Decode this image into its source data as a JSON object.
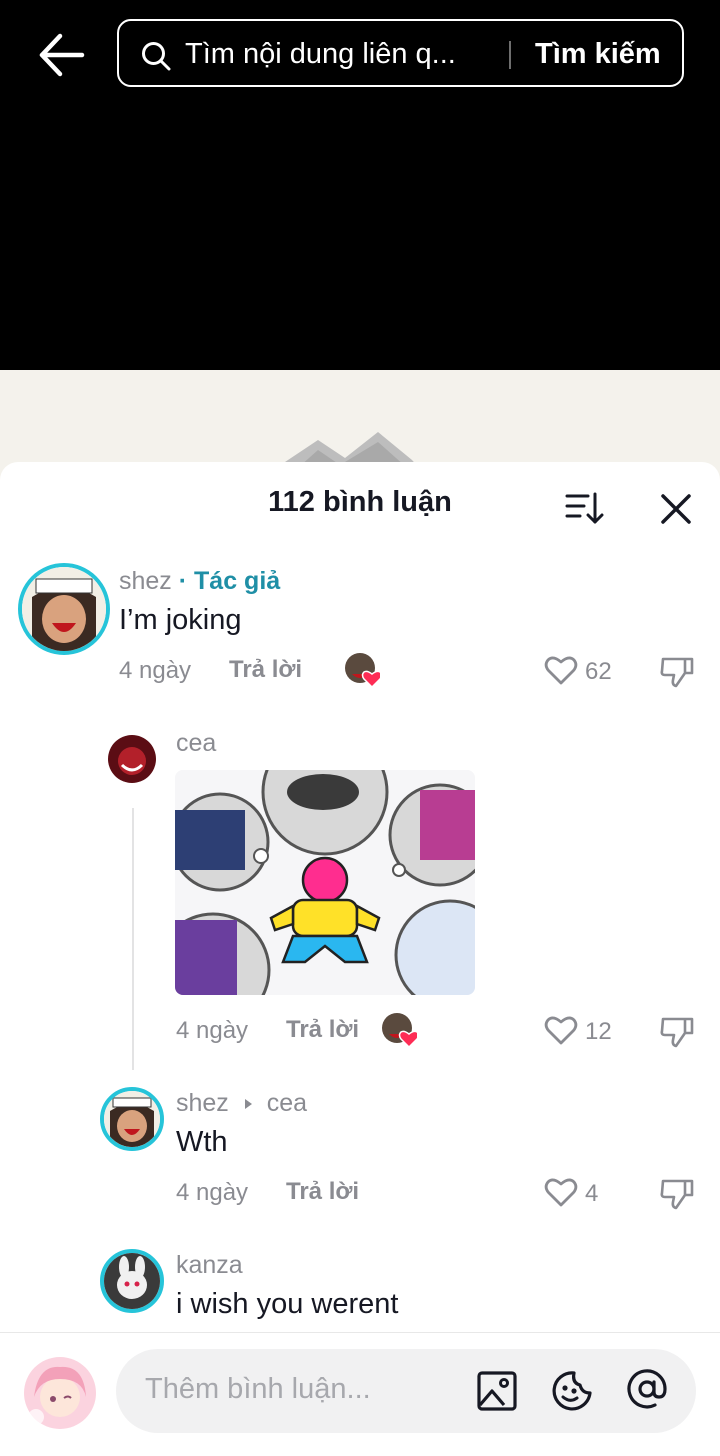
{
  "search": {
    "placeholder": "Tìm nội dung liên q...",
    "button": "Tìm kiếm"
  },
  "comments_header": {
    "title": "112 bình luận"
  },
  "comments": [
    {
      "user": "shez",
      "badge": "· Tác giả",
      "text": "I’m joking",
      "time": "4 ngày",
      "reply_label": "Trả lời",
      "likes": "62"
    },
    {
      "user": "cea",
      "text": "",
      "time": "4 ngày",
      "reply_label": "Trả lời",
      "likes": "12"
    },
    {
      "user": "shez",
      "reply_to": "cea",
      "text": "Wth",
      "time": "4 ngày",
      "reply_label": "Trả lời",
      "likes": "4"
    },
    {
      "user": "kanza",
      "text": "i wish you werent"
    }
  ],
  "composer": {
    "placeholder": "Thêm bình luận..."
  },
  "colors": {
    "accent_ring": "#26c4d9",
    "author_badge": "#1f8fa6",
    "heart": "#fe2c55"
  }
}
